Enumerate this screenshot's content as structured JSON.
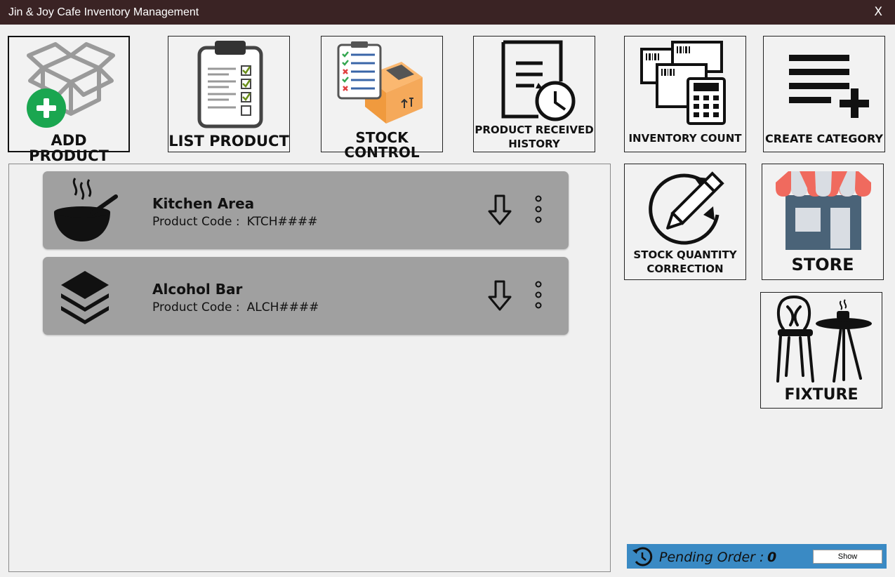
{
  "window": {
    "title": "Jin & Joy Cafe Inventory Management",
    "close_label": "X"
  },
  "tiles": {
    "add_product": "ADD PRODUCT",
    "list_product": "LIST PRODUCT",
    "stock_control": "STOCK CONTROL",
    "product_received_line1": "PRODUCT RECEIVED",
    "product_received_line2": "HISTORY",
    "inventory_count": "INVENTORY COUNT",
    "create_category": "CREATE CATEGORY",
    "stock_qty_line1": "STOCK QUANTITY",
    "stock_qty_line2": "CORRECTION",
    "store": "STORE",
    "fixture": "FIXTURE"
  },
  "categories": [
    {
      "name": "Kitchen Area",
      "code_label": "Product Code :",
      "code": "KTCH####",
      "icon": "cooking-pot-icon"
    },
    {
      "name": "Alcohol Bar",
      "code_label": "Product Code :",
      "code": "ALCH####",
      "icon": "layers-icon"
    }
  ],
  "pending": {
    "label": "Pending Order :",
    "count": "0",
    "button": "Show"
  },
  "colors": {
    "titlebar": "#3a2324",
    "card": "#a0a0a0",
    "pending_bar": "#3a8ac4",
    "add_green": "#1aa650",
    "box_orange": "#f5a04a",
    "store_awning": "#f06a5e",
    "store_body": "#4a6378"
  }
}
